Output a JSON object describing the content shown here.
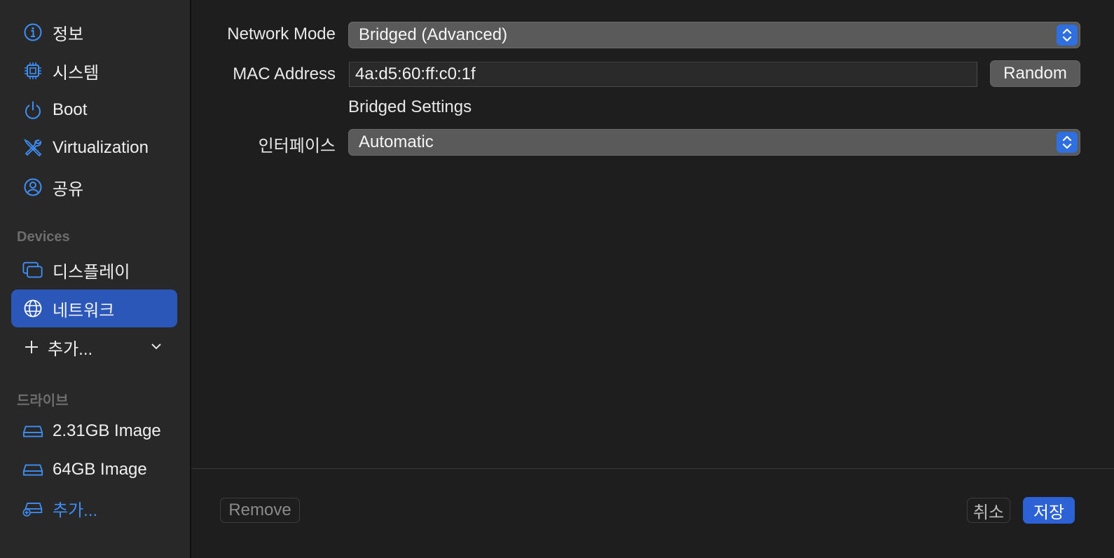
{
  "sidebar": {
    "items": [
      {
        "label": "정보",
        "icon": "info-icon"
      },
      {
        "label": "시스템",
        "icon": "cpu-icon"
      },
      {
        "label": "Boot",
        "icon": "power-icon"
      },
      {
        "label": "Virtualization",
        "icon": "tools-icon"
      },
      {
        "label": "공유",
        "icon": "person-circle-icon"
      }
    ],
    "devices_header": "Devices",
    "devices": [
      {
        "label": "디스플레이",
        "icon": "display-icon"
      },
      {
        "label": "네트워크",
        "icon": "globe-icon",
        "selected": true
      }
    ],
    "add_device_label": "추가...",
    "drives_header": "드라이브",
    "drives": [
      {
        "label": "2.31GB Image",
        "icon": "drive-icon"
      },
      {
        "label": "64GB Image",
        "icon": "drive-icon"
      }
    ],
    "add_drive_label": "추가..."
  },
  "form": {
    "network_mode_label": "Network Mode",
    "network_mode_value": "Bridged (Advanced)",
    "mac_address_label": "MAC Address",
    "mac_address_value": "4a:d5:60:ff:c0:1f",
    "random_button": "Random",
    "bridged_settings_title": "Bridged Settings",
    "interface_label": "인터페이스",
    "interface_value": "Automatic"
  },
  "footer": {
    "remove_button": "Remove",
    "cancel_button": "취소",
    "save_button": "저장"
  },
  "colors": {
    "accent": "#2d62d6",
    "selected_row": "#2b57b8",
    "icon_blue": "#3e8ef7"
  }
}
